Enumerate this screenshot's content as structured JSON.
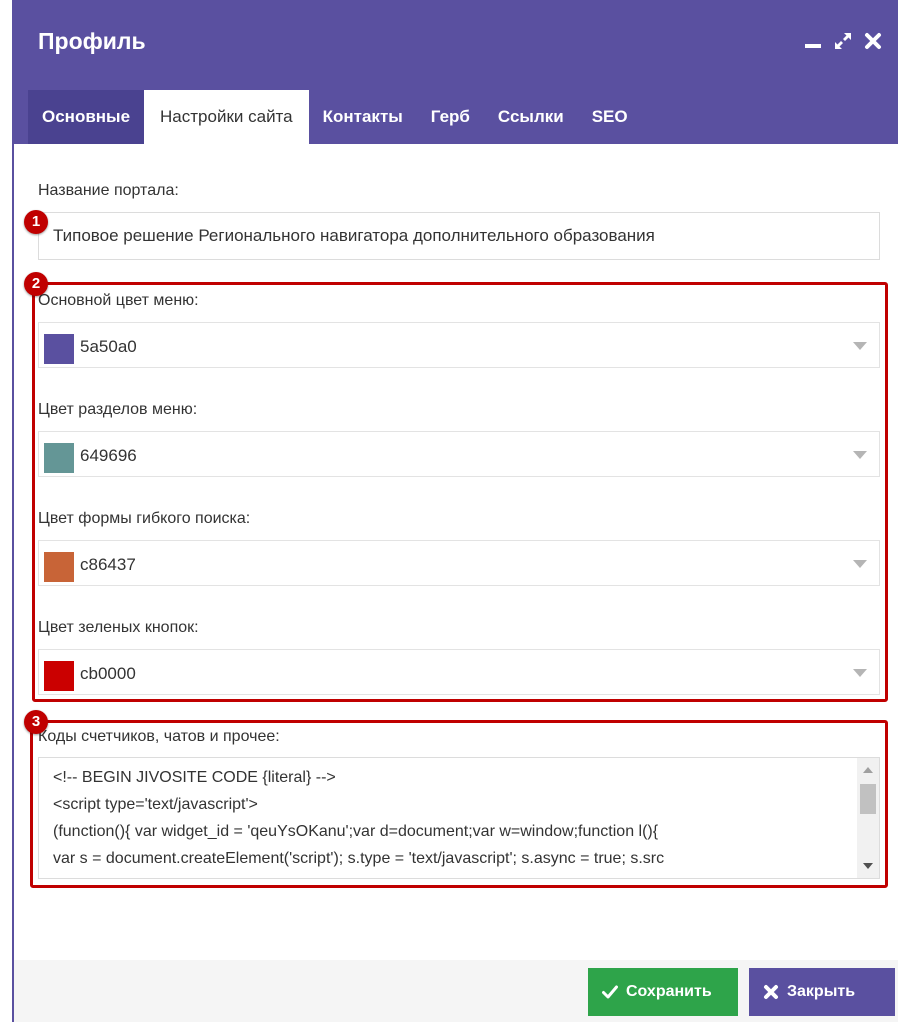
{
  "window": {
    "title": "Профиль",
    "controls": [
      "minimize-icon",
      "maximize-icon",
      "close-icon"
    ]
  },
  "tabs": [
    {
      "label": "Основные",
      "active": false
    },
    {
      "label": "Настройки сайта",
      "active": true
    },
    {
      "label": "Контакты",
      "active": false
    },
    {
      "label": "Герб",
      "active": false
    },
    {
      "label": "Ссылки",
      "active": false
    },
    {
      "label": "SEO",
      "active": false
    }
  ],
  "portal": {
    "label": "Название портала:",
    "value": "Типовое решение Регионального навигатора дополнительного образования"
  },
  "colors": [
    {
      "label": "Основной цвет меню:",
      "value": "5a50a0",
      "swatch": "#5a50a0"
    },
    {
      "label": "Цвет разделов меню:",
      "value": "649696",
      "swatch": "#649696"
    },
    {
      "label": "Цвет формы гибкого поиска:",
      "value": "c86437",
      "swatch": "#c86437"
    },
    {
      "label": "Цвет зеленых кнопок:",
      "value": "cb0000",
      "swatch": "#cb0000"
    }
  ],
  "counters": {
    "label": "Коды счетчиков, чатов и прочее:",
    "lines": [
      "<!-- BEGIN JIVOSITE CODE {literal} -->",
      "<script type='text/javascript'>",
      "(function(){ var widget_id = 'qeuYsOKanu';var d=document;var w=window;function l(){",
      "var s = document.createElement('script'); s.type = 'text/javascript'; s.async = true; s.src"
    ]
  },
  "annotations": [
    "1",
    "2",
    "3"
  ],
  "buttons": {
    "save": "Сохранить",
    "close": "Закрыть"
  },
  "theme": {
    "primary": "#5a50a0",
    "tab_dark": "#4a4290",
    "success": "#2ea44a",
    "annotation_red": "#c00000"
  }
}
